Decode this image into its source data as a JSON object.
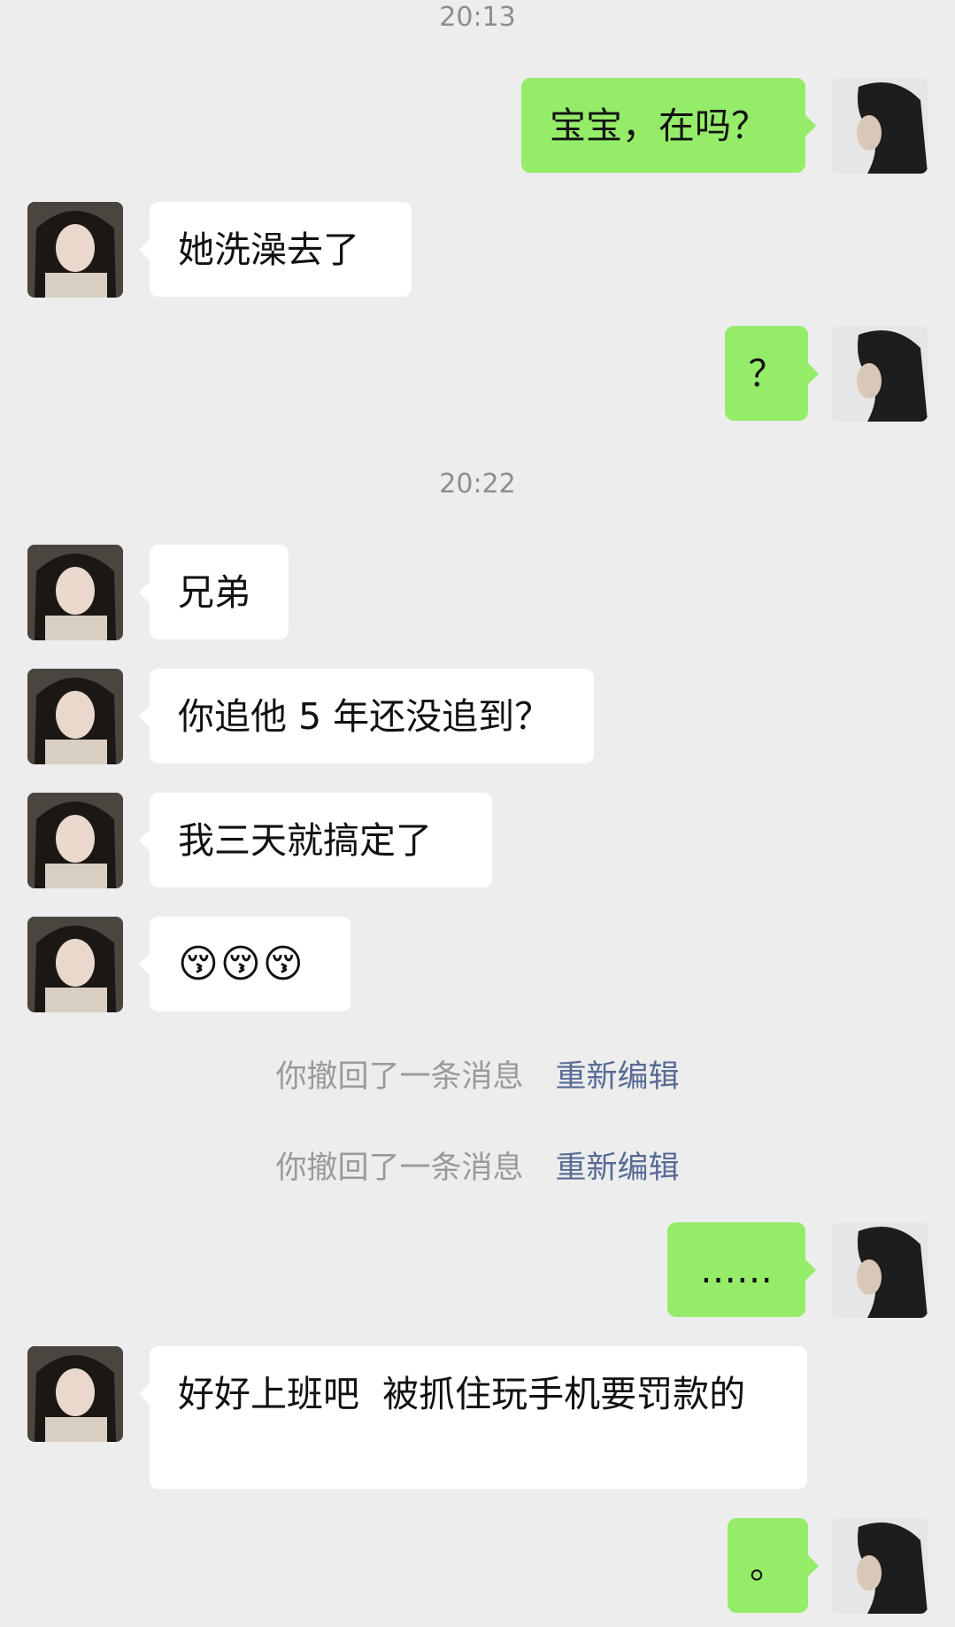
{
  "timestamps": [
    "20:13",
    "20:22"
  ],
  "messages": {
    "m1": "宝宝，在吗？",
    "m2": "她洗澡去了",
    "m3": "？",
    "m4": "兄弟",
    "m5": "你追他 5 年还没追到？",
    "m6": "我三天就搞定了",
    "m7": "😚😚😚",
    "m8": "……",
    "m9": "好好上班吧  被抓住玩手机要罚款的",
    "m10": "。"
  },
  "recall": {
    "text": "你撤回了一条消息",
    "edit": "重新编辑"
  },
  "icons": {
    "me_avatar": "avatar-me-icon",
    "her_avatar": "avatar-her-icon"
  },
  "colors": {
    "background": "#ededed",
    "sent_bubble": "#95ec69",
    "received_bubble": "#ffffff",
    "timestamp": "#8e8e8e",
    "edit_link": "#576b95"
  }
}
